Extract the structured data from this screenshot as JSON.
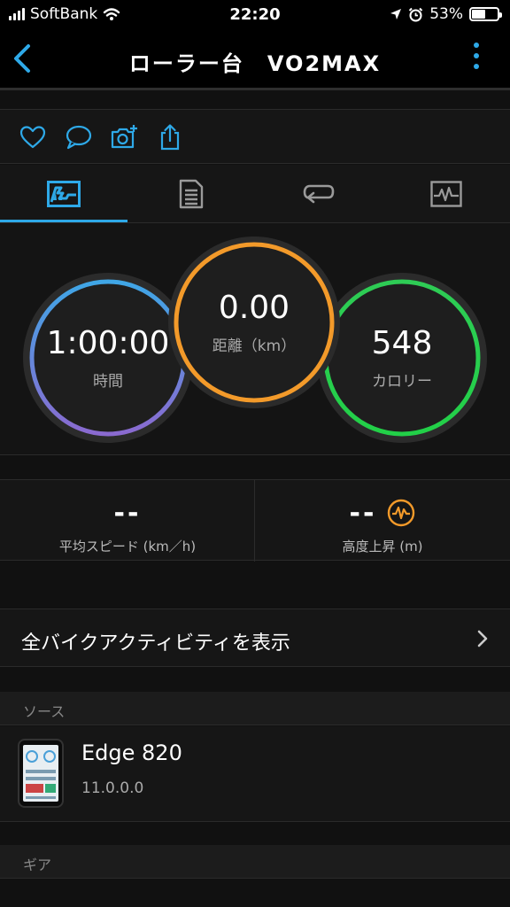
{
  "status_bar": {
    "carrier": "SoftBank",
    "time": "22:20",
    "battery": "53%",
    "battery_level": 0.53,
    "icons": [
      "signal-icon",
      "wifi-icon",
      "location-icon",
      "alarm-icon",
      "battery-icon"
    ]
  },
  "nav": {
    "title": "ローラー台　VO2MAX",
    "back_icon": "chevron-left-icon",
    "more_icon": "more-vertical-icon",
    "accent_color": "#2ea9e8"
  },
  "social_actions": [
    "like-icon",
    "comment-icon",
    "add-photo-icon",
    "share-icon"
  ],
  "tabs": [
    {
      "icon": "overview-icon",
      "active": true
    },
    {
      "icon": "details-icon",
      "active": false
    },
    {
      "icon": "laps-icon",
      "active": false
    },
    {
      "icon": "graph-icon",
      "active": false
    }
  ],
  "gauges": [
    {
      "key": "time",
      "value": "1:00:00",
      "label": "時間",
      "colors": [
        "#3fa6e6",
        "#8a6ad0"
      ]
    },
    {
      "key": "distance",
      "value": "0.00",
      "label": "距離（km）",
      "colors": [
        "#f39a2a"
      ]
    },
    {
      "key": "calories",
      "value": "548",
      "label": "カロリー",
      "colors": [
        "#2ecc55",
        "#22d048"
      ]
    }
  ],
  "stats": [
    {
      "value": "--",
      "label": "平均スピード (km／h)",
      "icon": null
    },
    {
      "value": "--",
      "label": "高度上昇 (m)",
      "icon": "elevation-icon",
      "icon_color": "#f39a2a"
    }
  ],
  "all_bike": {
    "label": "全バイクアクティビティを表示",
    "icon": "chevron-right-icon"
  },
  "source": {
    "header": "ソース",
    "device_name": "Edge 820",
    "device_version": "11.0.0.0"
  },
  "gear": {
    "header": "ギア"
  }
}
